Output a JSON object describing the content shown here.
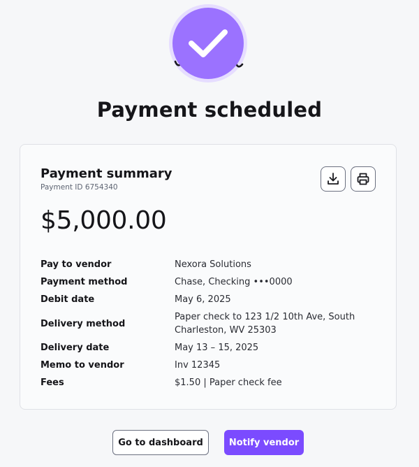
{
  "header": {
    "title": "Payment scheduled",
    "status_icon": "check-icon",
    "accent_color": "#9b72ff"
  },
  "summary": {
    "heading": "Payment summary",
    "payment_id": "Payment ID 6754340",
    "amount": "$5,000.00",
    "download_icon": "download-icon",
    "print_icon": "printer-icon",
    "rows": [
      {
        "label": "Pay to vendor",
        "value": "Nexora Solutions"
      },
      {
        "label": "Payment method",
        "value": "Chase, Checking •••0000"
      },
      {
        "label": "Debit date",
        "value": "May 6, 2025"
      },
      {
        "label": "Delivery method",
        "value": "Paper check to 123 1/2 10th Ave, South Charleston, WV 25303"
      },
      {
        "label": "Delivery date",
        "value": "May 13 – 15, 2025"
      },
      {
        "label": "Memo to vendor",
        "value": "Inv 12345"
      },
      {
        "label": "Fees",
        "value": "$1.50 | Paper check fee"
      }
    ]
  },
  "actions": {
    "dashboard_label": "Go to dashboard",
    "notify_label": "Notify vendor",
    "primary_color": "#7b4bff"
  }
}
